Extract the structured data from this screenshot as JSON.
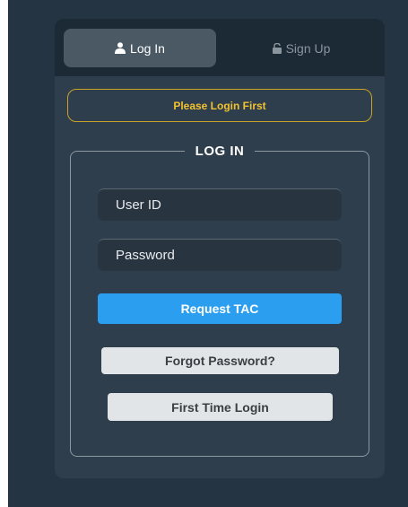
{
  "tabs": {
    "login_label": "Log In",
    "signup_label": "Sign Up",
    "login_icon": "user-icon",
    "signup_icon": "unlock-icon"
  },
  "alert": {
    "message": "Please Login First"
  },
  "form": {
    "legend": "LOG IN",
    "user_id_placeholder": "User ID",
    "password_placeholder": "Password",
    "request_tac_label": "Request TAC",
    "forgot_password_label": "Forgot Password?",
    "first_time_login_label": "First Time Login"
  },
  "colors": {
    "background": "#243442",
    "card": "#2e3e4c",
    "accent_blue": "#2b9ef0",
    "alert_yellow": "#f2c230"
  }
}
